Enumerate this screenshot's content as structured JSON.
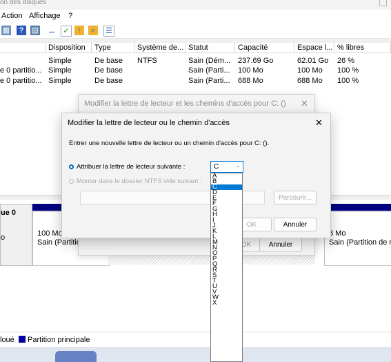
{
  "window": {
    "title": "on des disques"
  },
  "menu": [
    "Action",
    "Affichage",
    "?"
  ],
  "toolbar_icons": [
    "disk-icon",
    "help-icon",
    "properties-icon",
    "minus-icon",
    "check-icon",
    "up-icon",
    "search-icon",
    "list-icon"
  ],
  "volumes": {
    "columns": [
      "Disposition",
      "Type",
      "Système de...",
      "Statut",
      "Capacité",
      "Espace l...",
      "% libres"
    ],
    "rows": [
      {
        "name": "",
        "layout": "Simple",
        "type": "De base",
        "fs": "NTFS",
        "status": "Sain (Dém...",
        "capacity": "237.69 Go",
        "free": "62.01 Go",
        "pct": "26 %"
      },
      {
        "name": "e 0 partitio...",
        "layout": "Simple",
        "type": "De base",
        "fs": "",
        "status": "Sain (Parti...",
        "capacity": "100 Mo",
        "free": "100 Mo",
        "pct": "100 %"
      },
      {
        "name": "e 0 partitio...",
        "layout": "Simple",
        "type": "De base",
        "fs": "",
        "status": "Sain (Parti...",
        "capacity": "688 Mo",
        "free": "688 Mo",
        "pct": "100 %"
      }
    ]
  },
  "disk": {
    "label": "ue 0",
    "label2": "o",
    "part1_size": "100 Mo",
    "part1_status": "Sain (Partitio",
    "part3_size": "8 Mo",
    "part3_status": "Sain (Partition de récu"
  },
  "legend": {
    "unalloc": "loué",
    "primary": "Partition principale"
  },
  "bg_dialog": {
    "title": "Modifier la lettre de lecteur et les chemins d'accès pour C: ()",
    "ok": "OK",
    "cancel": "Annuler"
  },
  "dialog": {
    "title": "Modifier la lettre de lecteur ou le chemin d'accès",
    "instruction": "Entrer une nouvelle lettre de lecteur ou un chemin d'accès pour C: ().",
    "opt_letter": "Attribuer la lettre de lecteur suivante :",
    "opt_folder": "Monter dans le dossier NTFS vide suivant :",
    "selected_letter": "C",
    "browse": "Parcourir...",
    "ok": "OK",
    "cancel": "Annuler"
  },
  "letters": [
    "A",
    "B",
    "C",
    "D",
    "E",
    "F",
    "G",
    "H",
    "I",
    "J",
    "K",
    "L",
    "M",
    "N",
    "O",
    "P",
    "Q",
    "R",
    "S",
    "T",
    "U",
    "V",
    "W",
    "X"
  ],
  "colors": {
    "accent": "#0078d4",
    "primary_partition": "#00009c",
    "disk_bar": "#000080"
  }
}
